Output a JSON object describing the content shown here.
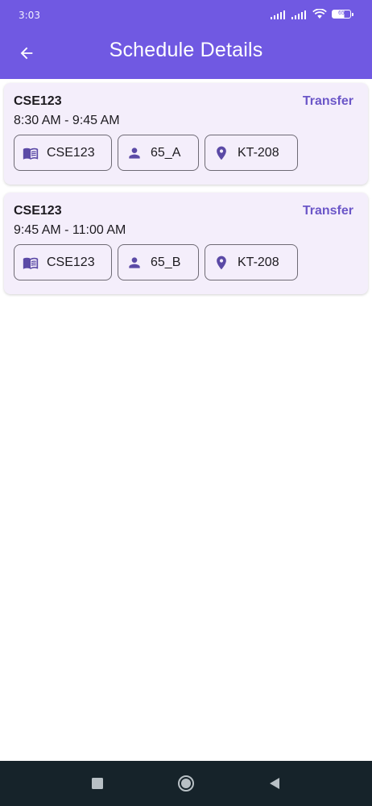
{
  "status_bar": {
    "time": "3:03",
    "battery": "65"
  },
  "header": {
    "title": "Schedule Details"
  },
  "schedules": [
    {
      "course_code": "CSE123",
      "time": "8:30 AM - 9:45 AM",
      "transfer_label": "Transfer",
      "course_chip": "CSE123",
      "group_chip": "65_A",
      "room_chip": "KT-208"
    },
    {
      "course_code": "CSE123",
      "time": "9:45 AM - 11:00 AM",
      "transfer_label": "Transfer",
      "course_chip": "CSE123",
      "group_chip": "65_B",
      "room_chip": "KT-208"
    }
  ],
  "icons": {
    "back": "arrow-left-icon",
    "course": "book-icon",
    "group": "person-icon",
    "room": "location-pin-icon"
  },
  "colors": {
    "app_bar": "#7059e2",
    "card_background": "#f4eefb",
    "accent": "#6b56c8",
    "nav_bar": "#16232a"
  }
}
